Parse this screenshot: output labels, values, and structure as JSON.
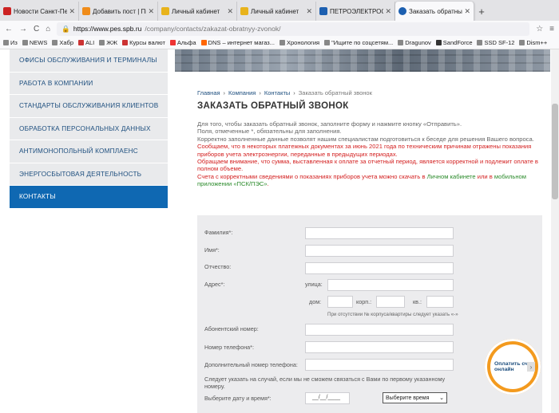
{
  "tabs": [
    {
      "label": "Новости Санкт-Петер",
      "icon_color": "#cc2222"
    },
    {
      "label": "Добавить пост | Пикаб",
      "icon_color": "#f08c1a"
    },
    {
      "label": "Личный кабинет",
      "icon_color": "#e8b31c"
    },
    {
      "label": "Личный кабинет",
      "icon_color": "#e8b31c"
    },
    {
      "label": "ПЕТРОЭЛЕКТРОСБЫТ",
      "icon_color": "#1c5fb0"
    },
    {
      "label": "Заказать обратный зв",
      "icon_color": "#1c5fb0"
    }
  ],
  "newtab_label": "+",
  "toolbar": {
    "back": "←",
    "forward": "→",
    "reload": "C",
    "home": "⌂",
    "url_domain": "https://www.pes.spb.ru",
    "url_path": "/company/contacts/zakazat-obratnyy-zvonok/"
  },
  "bookmarks": [
    "Из",
    "NEWS",
    "Хабр",
    "ALI",
    "ЖЖ",
    "Курсы валют",
    "Альфа",
    "DNS – интернет магаз...",
    "Хронология",
    "\"Ищите по соцсетям...",
    "Dragunov",
    "SandForce",
    "SSD SF-12",
    "Dism++"
  ],
  "sidebar": {
    "items": [
      "ОФИСЫ ОБСЛУЖИВАНИЯ И ТЕРМИНАЛЫ",
      "РАБОТА В КОМПАНИИ",
      "СТАНДАРТЫ ОБСЛУЖИВАНИЯ КЛИЕНТОВ",
      "ОБРАБОТКА ПЕРСОНАЛЬНЫХ ДАННЫХ",
      "АНТИМОНОПОЛЬНЫЙ КОМПЛАЕНС",
      "ЭНЕРГОСБЫТОВАЯ ДЕЯТЕЛЬНОСТЬ",
      "КОНТАКТЫ"
    ]
  },
  "breadcrumb": {
    "home": "Главная",
    "company": "Компания",
    "contacts": "Контакты",
    "current": "Заказать обратный звонок"
  },
  "page_title": "ЗАКАЗАТЬ ОБРАТНЫЙ ЗВОНОК",
  "intro": {
    "p1": "Для того, чтобы заказать обратный звонок, заполните форму и нажмите кнопку «Отправить».",
    "p2": "Поля, отмеченные *, обязательны для заполнения.",
    "p3": "Корректно заполненные данные позволят нашим специалистам подготовиться к беседе для решения Вашего вопроса.",
    "p4": "Сообщаем, что в некоторых платежных документах за июнь 2021 года по техническим причинам отражены показания приборов учета электроэнергии, переданные в предыдущих периодах.",
    "p5": "Обращаем внимание, что сумма, выставленная к оплате за отчетный период, является корректной и подлежит оплате в полном объеме.",
    "p6a": "Счета с корректными сведениями о показаниях приборов учета можно скачать в ",
    "p6_link1": "Личном кабинете",
    "p6b": " или в ",
    "p6_link2": "мобильном приложении «ПСК/ПЭС»",
    "p6c": "."
  },
  "form": {
    "surname": "Фамилия*:",
    "name": "Имя*:",
    "patronymic": "Отчество:",
    "address": "Адрес*:",
    "street": "улица:",
    "house": "дом:",
    "corp": "корп.:",
    "flat": "кв.:",
    "address_hint": "При отсутствии № корпуса/квартиры следует указать «-»",
    "account": "Абонентский номер:",
    "phone": "Номер телефона*:",
    "extra_phone": "Дополнительный номер телефона:",
    "extra_hint": "Следует указать на случай, если мы не сможем связаться с Вами по первому указанному номеру.",
    "datetime": "Выберите дату и время*:",
    "date_placeholder": "__/__/____",
    "time_select": "Выберите время"
  },
  "pay_button": "Оплатить счет онлайн",
  "colors": {
    "sidebar_active": "#0f68b2",
    "link": "#1d4e7e",
    "notice_red": "#d31f1f",
    "pay_orange": "#f39a1e"
  }
}
